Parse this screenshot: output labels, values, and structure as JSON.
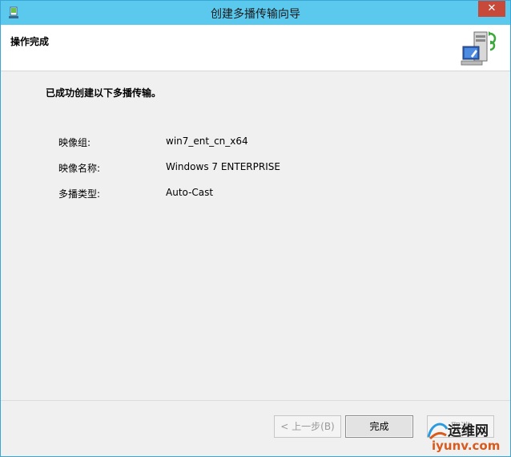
{
  "window": {
    "title": "创建多播传输向导",
    "close_label": "✕"
  },
  "header": {
    "title": "操作完成",
    "icon": "server-network-icon"
  },
  "content": {
    "message": "已成功创建以下多播传输。",
    "rows": [
      {
        "label": "映像组:",
        "value": "win7_ent_cn_x64"
      },
      {
        "label": "映像名称:",
        "value": "Windows 7 ENTERPRISE"
      },
      {
        "label": "多播类型:",
        "value": "Auto-Cast"
      }
    ]
  },
  "buttons": {
    "back": "< 上一步(B)",
    "finish": "完成",
    "cancel": "取消"
  },
  "watermark": {
    "line1": "运维网",
    "line2": "iyunv.com"
  },
  "colors": {
    "titlebar": "#5bc8ee",
    "close": "#c7493a",
    "watermark_orange": "#d95a1c"
  }
}
